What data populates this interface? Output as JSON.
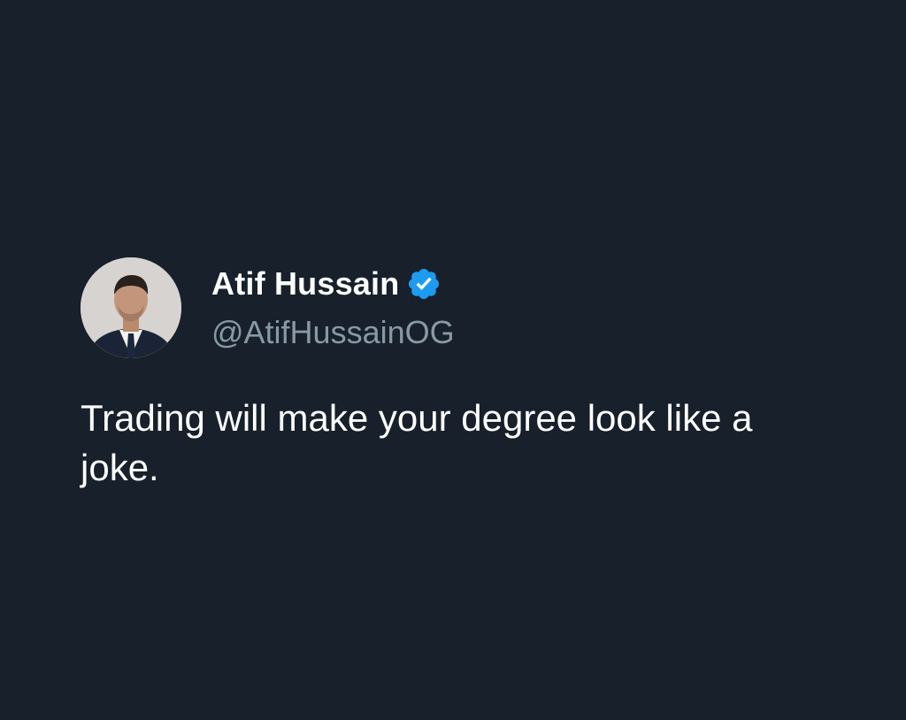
{
  "tweet": {
    "author": {
      "display_name": "Atif Hussain",
      "handle": "@AtifHussainOG",
      "verified": true,
      "avatar_icon": "profile-photo"
    },
    "text": "Trading will make your degree look like a joke."
  },
  "colors": {
    "background": "#17202b",
    "name": "#ffffff",
    "handle": "#8899a6",
    "text": "#ffffff",
    "verified": "#1d9bf0"
  }
}
